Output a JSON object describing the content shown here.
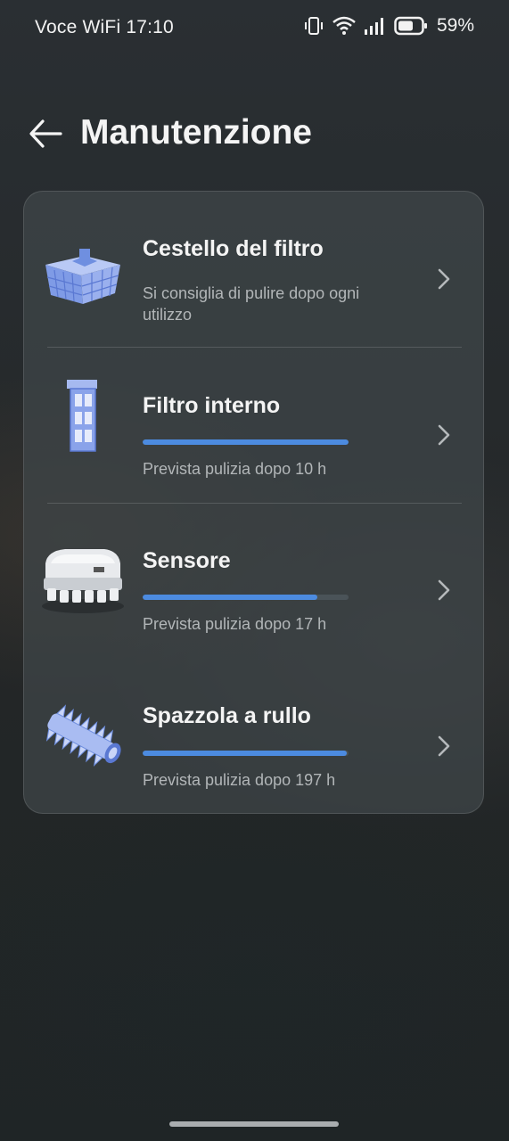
{
  "status_bar": {
    "left_text": "Voce WiFi 17:10",
    "battery_percent": "59%",
    "icons": [
      "vibrate-icon",
      "wifi-icon",
      "signal-icon",
      "battery-icon"
    ]
  },
  "header": {
    "back_icon": "arrow-left-icon",
    "title": "Manutenzione"
  },
  "colors": {
    "accent": "#4c8be0",
    "track": "#4a5358",
    "card": "#40464a"
  },
  "items": [
    {
      "title": "Cestello del filtro",
      "description": "Si consiglia di pulire dopo ogni utilizzo",
      "icon": "filter-basket-image"
    },
    {
      "title": "Filtro interno",
      "description": "Prevista pulizia dopo 10 h",
      "progress": 1.0,
      "icon": "inner-filter-image"
    },
    {
      "title": "Sensore",
      "description": "Prevista pulizia dopo 17 h",
      "progress": 0.85,
      "icon": "sensor-robot-image"
    },
    {
      "title": "Spazzola a rullo",
      "description": "Prevista pulizia dopo 197 h",
      "progress": 0.99,
      "icon": "roller-brush-image"
    }
  ]
}
